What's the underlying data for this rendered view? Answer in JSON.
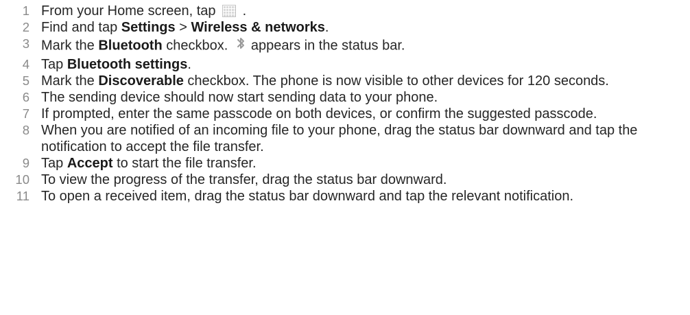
{
  "steps": [
    {
      "num": "1",
      "parts": [
        {
          "text": "From your Home screen, tap "
        },
        {
          "icon": "app-grid-icon"
        },
        {
          "text": " ."
        }
      ]
    },
    {
      "num": "2",
      "parts": [
        {
          "text": "Find and tap "
        },
        {
          "text": "Settings",
          "bold": true
        },
        {
          "text": " > "
        },
        {
          "text": "Wireless & networks",
          "bold": true
        },
        {
          "text": "."
        }
      ]
    },
    {
      "num": "3",
      "parts": [
        {
          "text": "Mark the "
        },
        {
          "text": "Bluetooth",
          "bold": true
        },
        {
          "text": " checkbox. "
        },
        {
          "icon": "bluetooth-icon"
        },
        {
          "text": "appears in the status bar."
        }
      ]
    },
    {
      "num": "4",
      "parts": [
        {
          "text": "Tap "
        },
        {
          "text": "Bluetooth settings",
          "bold": true
        },
        {
          "text": "."
        }
      ]
    },
    {
      "num": "5",
      "parts": [
        {
          "text": "Mark the "
        },
        {
          "text": "Discoverable",
          "bold": true
        },
        {
          "text": " checkbox. The phone is now visible to other devices for 120 seconds."
        }
      ]
    },
    {
      "num": "6",
      "parts": [
        {
          "text": "The sending device should now start sending data to your phone."
        }
      ]
    },
    {
      "num": "7",
      "parts": [
        {
          "text": "If prompted, enter the same passcode on both devices, or confirm the suggested passcode."
        }
      ]
    },
    {
      "num": "8",
      "parts": [
        {
          "text": "When you are notified of an incoming file to your phone, drag the status bar downward and tap the notification to accept the file transfer."
        }
      ]
    },
    {
      "num": "9",
      "parts": [
        {
          "text": "Tap "
        },
        {
          "text": "Accept",
          "bold": true
        },
        {
          "text": " to start the file transfer."
        }
      ]
    },
    {
      "num": "10",
      "parts": [
        {
          "text": "To view the progress of the transfer, drag the status bar downward."
        }
      ]
    },
    {
      "num": "11",
      "parts": [
        {
          "text": "To open a received item, drag the status bar downward and tap the relevant notification."
        }
      ]
    }
  ]
}
